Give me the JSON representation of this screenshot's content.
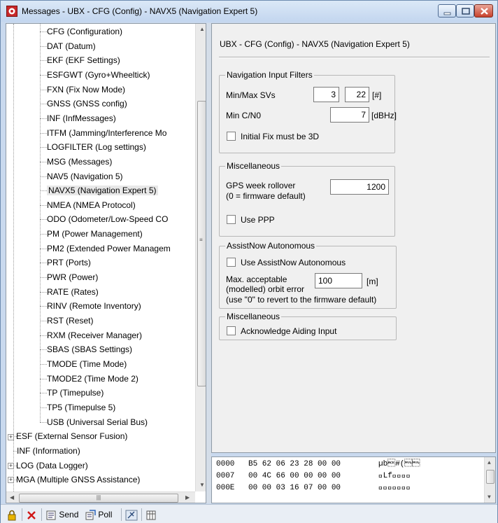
{
  "window": {
    "title": "Messages - UBX - CFG (Config) - NAVX5 (Navigation Expert 5)"
  },
  "tree": {
    "items": [
      {
        "label": "CFG (Configuration)",
        "level": 2
      },
      {
        "label": "DAT (Datum)",
        "level": 2
      },
      {
        "label": "EKF (EKF Settings)",
        "level": 2
      },
      {
        "label": "ESFGWT (Gyro+Wheeltick)",
        "level": 2
      },
      {
        "label": "FXN (Fix Now Mode)",
        "level": 2
      },
      {
        "label": "GNSS (GNSS config)",
        "level": 2
      },
      {
        "label": "INF (InfMessages)",
        "level": 2
      },
      {
        "label": "ITFM (Jamming/Interference Mo",
        "level": 2
      },
      {
        "label": "LOGFILTER (Log settings)",
        "level": 2
      },
      {
        "label": "MSG (Messages)",
        "level": 2
      },
      {
        "label": "NAV5 (Navigation 5)",
        "level": 2
      },
      {
        "label": "NAVX5 (Navigation Expert 5)",
        "level": 2,
        "selected": true
      },
      {
        "label": "NMEA (NMEA Protocol)",
        "level": 2
      },
      {
        "label": "ODO (Odometer/Low-Speed CO",
        "level": 2
      },
      {
        "label": "PM (Power Management)",
        "level": 2
      },
      {
        "label": "PM2 (Extended Power Managem",
        "level": 2
      },
      {
        "label": "PRT (Ports)",
        "level": 2
      },
      {
        "label": "PWR (Power)",
        "level": 2
      },
      {
        "label": "RATE (Rates)",
        "level": 2
      },
      {
        "label": "RINV (Remote Inventory)",
        "level": 2
      },
      {
        "label": "RST (Reset)",
        "level": 2
      },
      {
        "label": "RXM (Receiver Manager)",
        "level": 2
      },
      {
        "label": "SBAS (SBAS Settings)",
        "level": 2
      },
      {
        "label": "TMODE (Time Mode)",
        "level": 2
      },
      {
        "label": "TMODE2 (Time Mode 2)",
        "level": 2
      },
      {
        "label": "TP (Timepulse)",
        "level": 2
      },
      {
        "label": "TP5 (Timepulse 5)",
        "level": 2
      },
      {
        "label": "USB (Universal Serial Bus)",
        "level": 2
      },
      {
        "label": "ESF (External Sensor Fusion)",
        "level": 1,
        "expander": "+"
      },
      {
        "label": "INF (Information)",
        "level": 1
      },
      {
        "label": "LOG (Data Logger)",
        "level": 1,
        "expander": "+"
      },
      {
        "label": "MGA (Multiple GNSS Assistance)",
        "level": 1,
        "expander": "+"
      }
    ]
  },
  "panel": {
    "title": "UBX - CFG (Config) - NAVX5 (Navigation Expert 5)",
    "nav_filters": {
      "label": "Navigation Input Filters",
      "minmax_label": "Min/Max SVs",
      "min_svs": "3",
      "max_svs": "22",
      "svs_unit": "[#]",
      "cno_label": "Min C/N0",
      "cno_value": "7",
      "cno_unit": "[dBHz]",
      "fix3d_label": "Initial Fix must be 3D"
    },
    "misc1": {
      "label": "Miscellaneous",
      "rollover_label_1": "GPS week rollover",
      "rollover_label_2": "(0 = firmware default)",
      "rollover_value": "1200",
      "ppp_label": "Use PPP"
    },
    "assistnow": {
      "label": "AssistNow Autonomous",
      "use_label": "Use AssistNow Autonomous",
      "orbit_label_1": "Max. acceptable",
      "orbit_label_2": "(modelled) orbit error",
      "orbit_value": "100",
      "orbit_unit": "[m]",
      "hint": "(use \"0\" to revert to the firmware default)"
    },
    "misc2": {
      "label": "Miscellaneous",
      "ack_label": "Acknowledge Aiding Input"
    }
  },
  "hex": {
    "rows": [
      {
        "addr": "0000",
        "bytes": "B5 62 06 23 28 00 00",
        "ascii": "µb\u0006#(\u0000\u0000"
      },
      {
        "addr": "0007",
        "bytes": "00 4C 66 00 00 00 00",
        "ascii": "\u0000Lf\u0000\u0000\u0000\u0000"
      },
      {
        "addr": "000E",
        "bytes": "00 00 03 16 07 00 00",
        "ascii": "\u0000\u0000\u0003\u0016\u0007\u0000\u0000"
      }
    ]
  },
  "toolbar": {
    "send_label": "Send",
    "poll_label": "Poll"
  }
}
